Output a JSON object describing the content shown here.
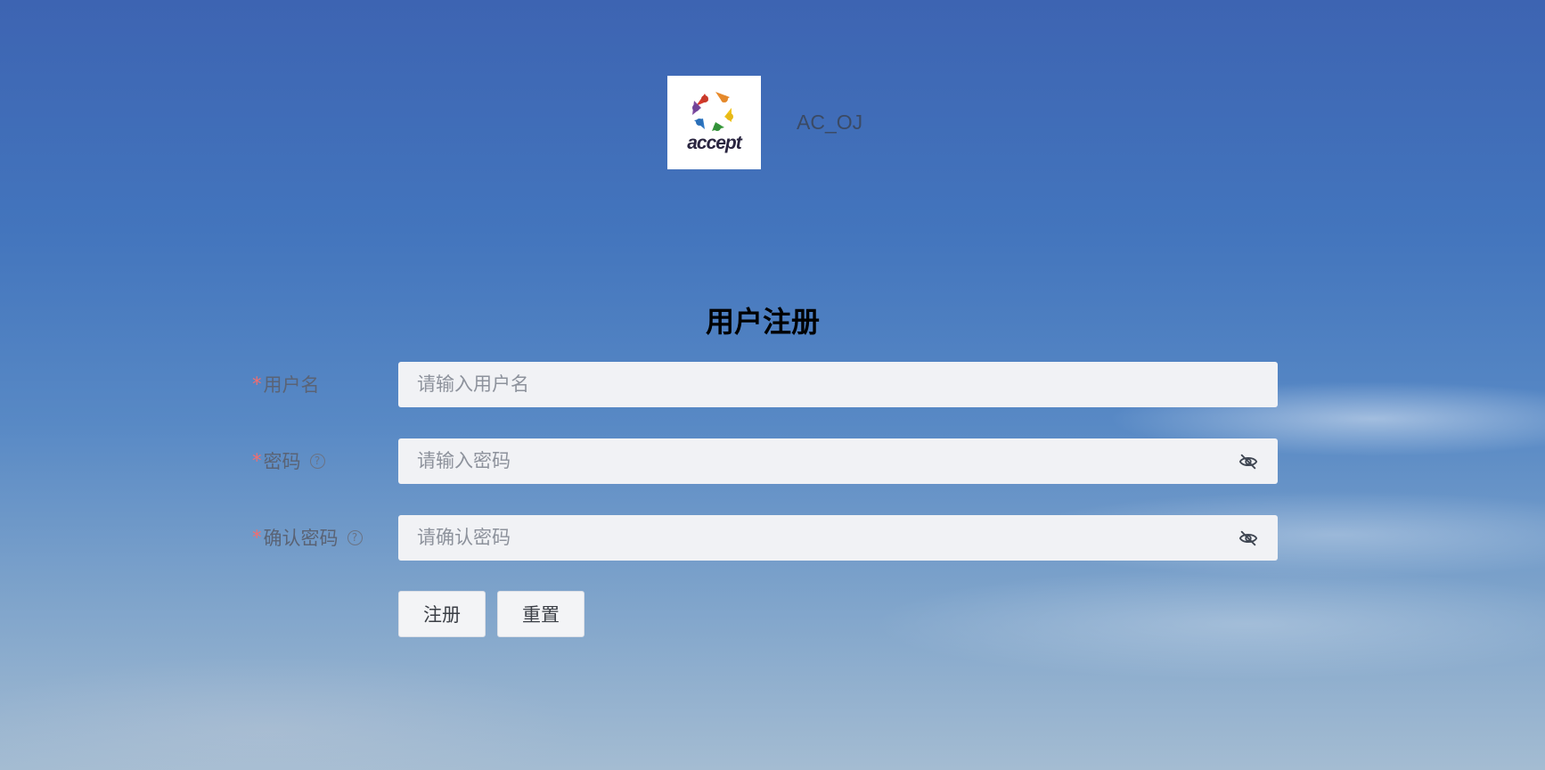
{
  "header": {
    "logo_text": "accept",
    "brand": "AC_OJ"
  },
  "form": {
    "title": "用户注册",
    "fields": [
      {
        "label": "用户名",
        "placeholder": "请输入用户名",
        "required": true,
        "help": false,
        "icon": ""
      },
      {
        "label": "密码",
        "placeholder": "请输入密码",
        "required": true,
        "help": true,
        "icon": "eye-off-icon"
      },
      {
        "label": "确认密码",
        "placeholder": "请确认密码",
        "required": true,
        "help": true,
        "icon": "eye-off-icon"
      }
    ],
    "required_mark": "*",
    "help_glyph": "?",
    "buttons": {
      "register": "注册",
      "reset": "重置"
    }
  },
  "colors": {
    "required": "#f56c6c",
    "input_bg": "#f1f2f5"
  }
}
